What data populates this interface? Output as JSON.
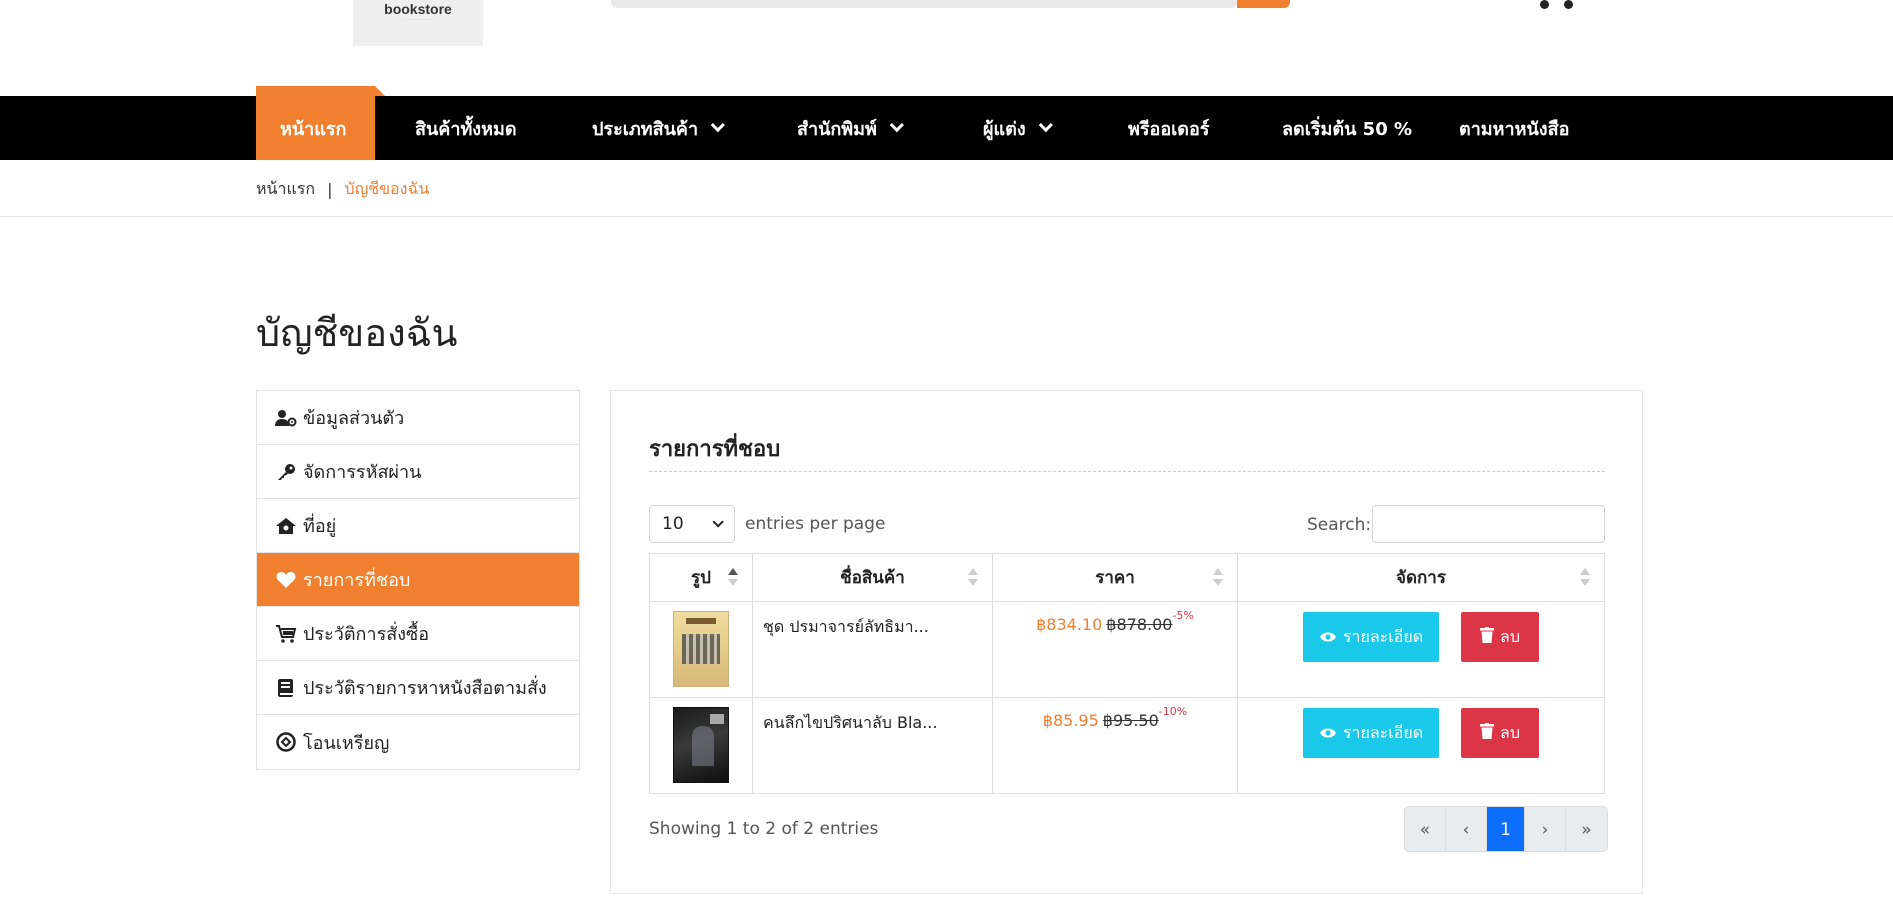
{
  "header": {
    "logo_text": "bookstore",
    "logo_sub": "·············"
  },
  "nav": {
    "items": [
      {
        "label": "หน้าแรก",
        "active": true,
        "dropdown": false
      },
      {
        "label": "สินค้าทั้งหมด",
        "dropdown": false
      },
      {
        "label": "ประเภทสินค้า",
        "dropdown": true
      },
      {
        "label": "สำนักพิมพ์",
        "dropdown": true
      },
      {
        "label": "ผู้แต่ง",
        "dropdown": true
      },
      {
        "label": "พรีออเดอร์",
        "dropdown": false
      },
      {
        "label": "ลดเริ่มต้น 50 %",
        "dropdown": false
      },
      {
        "label": "ตามหาหนังสือ",
        "dropdown": false
      }
    ]
  },
  "breadcrumb": {
    "home": "หน้าแรก",
    "separator": "|",
    "current": "บัญชีของฉัน"
  },
  "page": {
    "title": "บัญชีของฉัน"
  },
  "sidebar": {
    "items": [
      {
        "label": "ข้อมูลส่วนตัว",
        "icon": "user-cog-icon"
      },
      {
        "label": "จัดการรหัสผ่าน",
        "icon": "key-icon"
      },
      {
        "label": "ที่อยู่",
        "icon": "home-icon"
      },
      {
        "label": "รายการที่ชอบ",
        "icon": "heart-icon",
        "active": true
      },
      {
        "label": "ประวัติการสั่งซื้อ",
        "icon": "cart-icon"
      },
      {
        "label": "ประวัติรายการหาหนังสือตามสั่ง",
        "icon": "book-icon"
      },
      {
        "label": "โอนเหรียญ",
        "icon": "coin-icon"
      }
    ]
  },
  "wishlist": {
    "title": "รายการที่ชอบ",
    "entries_value": "10",
    "entries_label": "entries per page",
    "search_label": "Search:",
    "search_value": "",
    "columns": [
      "รูป",
      "ชื่อสินค้า",
      "ราคา",
      "จัดการ"
    ],
    "rows": [
      {
        "name": "ชุด ปรมาจารย์ลัทธิมา...",
        "price": "฿834.10",
        "old_price": "฿878.00",
        "discount": "-5%",
        "view_label": "รายละเอียด",
        "delete_label": "ลบ"
      },
      {
        "name": "คนลึกไขปริศนาลับ Bla...",
        "price": "฿85.95",
        "old_price": "฿95.50",
        "discount": "-10%",
        "view_label": "รายละเอียด",
        "delete_label": "ลบ"
      }
    ],
    "info": "Showing 1 to 2 of 2 entries",
    "pager": {
      "first": "«",
      "prev": "‹",
      "current": "1",
      "next": "›",
      "last": "»"
    }
  },
  "colors": {
    "accent": "#f08030",
    "nav_bg": "#000000",
    "view_btn": "#1ac8ea",
    "delete_btn": "#dc3545",
    "pager_active": "#0d6efd"
  }
}
